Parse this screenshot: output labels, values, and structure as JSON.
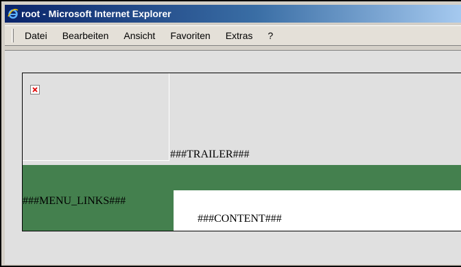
{
  "window": {
    "title": "root - Microsoft Internet Explorer",
    "icon": "ie-icon"
  },
  "menubar": {
    "items": [
      "Datei",
      "Bearbeiten",
      "Ansicht",
      "Favoriten",
      "Extras",
      "?"
    ]
  },
  "page": {
    "header": {
      "broken_image_icon": "broken-image-icon",
      "trailer_text": "###TRAILER###"
    },
    "menu_links_text": "###MENU_LINKS###",
    "content_text": "###CONTENT###",
    "colors": {
      "nav_green": "#44804e",
      "content_bg": "#ffffff",
      "page_bg": "#e0e0e0"
    }
  }
}
